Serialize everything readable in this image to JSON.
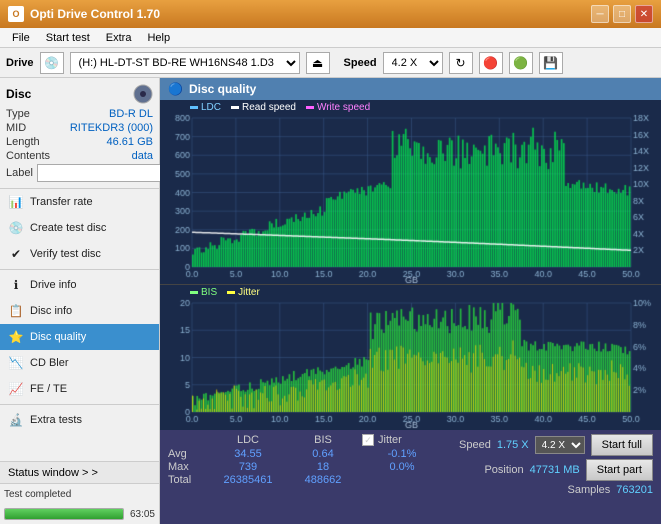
{
  "titleBar": {
    "title": "Opti Drive Control 1.70",
    "minBtn": "─",
    "maxBtn": "□",
    "closeBtn": "✕"
  },
  "menu": {
    "items": [
      "File",
      "Start test",
      "Extra",
      "Help"
    ]
  },
  "driveBar": {
    "label": "Drive",
    "driveValue": "(H:)  HL-DT-ST BD-RE  WH16NS48 1.D3",
    "speedLabel": "Speed",
    "speedValue": "4.2 X"
  },
  "disc": {
    "title": "Disc",
    "fields": [
      {
        "label": "Type",
        "value": "BD-R DL"
      },
      {
        "label": "MID",
        "value": "RITEKDR3 (000)"
      },
      {
        "label": "Length",
        "value": "46.61 GB"
      },
      {
        "label": "Contents",
        "value": "data"
      },
      {
        "label": "Label",
        "value": ""
      }
    ]
  },
  "nav": {
    "items": [
      {
        "id": "transfer-rate",
        "label": "Transfer rate",
        "icon": "📊"
      },
      {
        "id": "create-test-disc",
        "label": "Create test disc",
        "icon": "💿"
      },
      {
        "id": "verify-test-disc",
        "label": "Verify test disc",
        "icon": "✔"
      },
      {
        "id": "drive-info",
        "label": "Drive info",
        "icon": "ℹ"
      },
      {
        "id": "disc-info",
        "label": "Disc info",
        "icon": "📋"
      },
      {
        "id": "disc-quality",
        "label": "Disc quality",
        "icon": "⭐",
        "active": true
      },
      {
        "id": "cd-bler",
        "label": "CD Bler",
        "icon": "📉"
      },
      {
        "id": "fe-te",
        "label": "FE / TE",
        "icon": "📈"
      },
      {
        "id": "extra-tests",
        "label": "Extra tests",
        "icon": "🔬"
      }
    ]
  },
  "statusWindow": {
    "label": "Status window > >"
  },
  "statusBar": {
    "text": "Test completed",
    "progress": 100,
    "time": "63:05"
  },
  "chart": {
    "title": "Disc quality",
    "topLegend": {
      "ldc": "LDC",
      "readSpeed": "Read speed",
      "writeSpeed": "Write speed"
    },
    "bottomLegend": {
      "bis": "BIS",
      "jitter": "Jitter"
    },
    "topYAxisMax": 800,
    "topYRightMax": 18,
    "bottomYAxisMax": 20,
    "bottomYRightMax": 10,
    "xAxisMax": 50
  },
  "stats": {
    "headers": [
      "LDC",
      "BIS"
    ],
    "rows": [
      {
        "label": "Avg",
        "ldc": "34.55",
        "bis": "0.64",
        "jitter": "-0.1%"
      },
      {
        "label": "Max",
        "ldc": "739",
        "bis": "18",
        "jitter": "0.0%"
      },
      {
        "label": "Total",
        "ldc": "26385461",
        "bis": "488662",
        "jitter": ""
      }
    ],
    "jitterChecked": true,
    "jitterLabel": "Jitter",
    "speed": {
      "label": "Speed",
      "value": "1.75 X"
    },
    "speedSelect": "4.2 X",
    "position": {
      "label": "Position",
      "value": "47731 MB"
    },
    "samples": {
      "label": "Samples",
      "value": "763201"
    },
    "startFullBtn": "Start full",
    "startPartBtn": "Start part"
  }
}
